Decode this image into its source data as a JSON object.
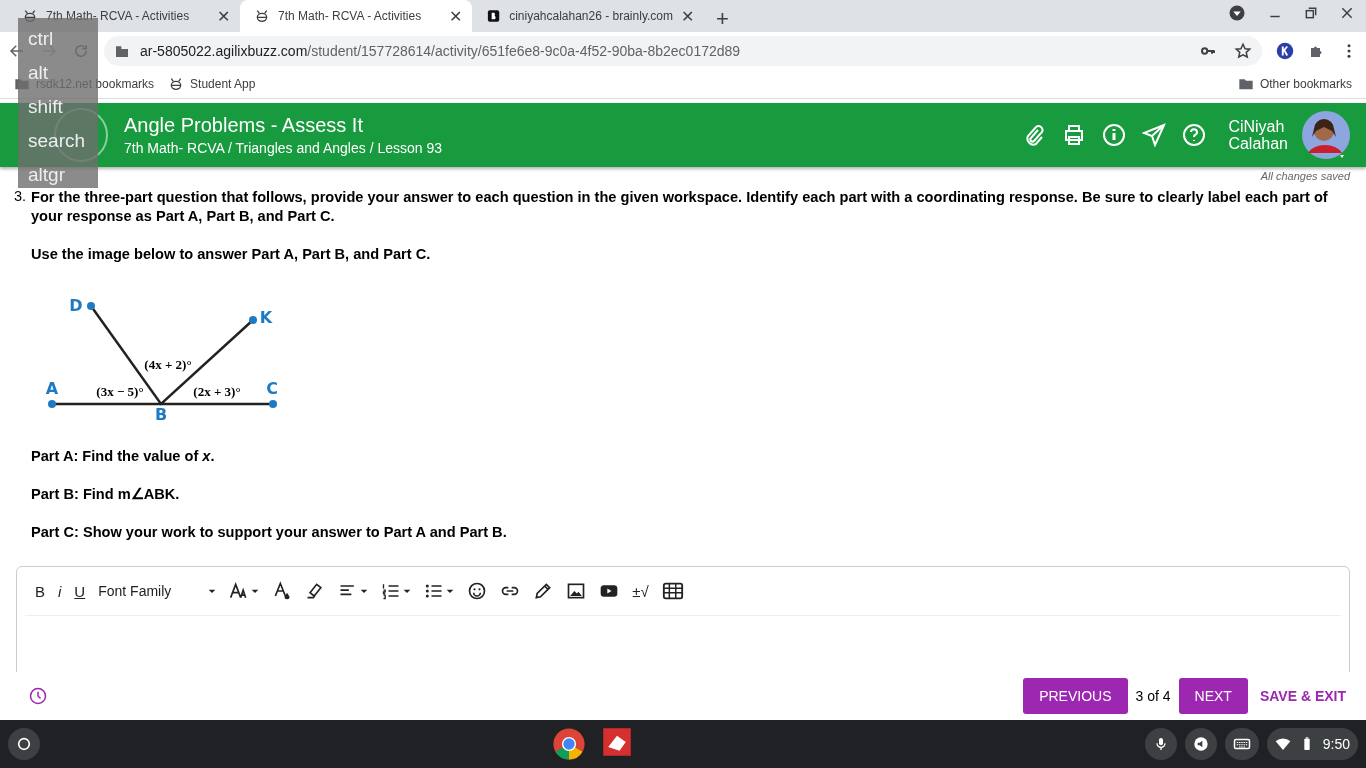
{
  "browser": {
    "tabs": [
      {
        "title": "7th Math- RCVA - Activities",
        "kind": "bee",
        "close": "✕",
        "selected": false
      },
      {
        "title": "7th Math- RCVA - Activities",
        "kind": "bee",
        "close": "✕",
        "selected": true
      },
      {
        "title": "ciniyahcalahan26 - brainly.com",
        "kind": "letter",
        "close": "✕",
        "selected": false
      }
    ],
    "new_tab": "+",
    "address": {
      "host": "ar-5805022.agilixbuzz.com",
      "path": "/student/157728614/activity/651fe6e8-9c0a-4f52-90ba-8b2ec0172d89"
    },
    "bookmarks": [
      {
        "label": "rsdk12.net bookmarks",
        "kind": "folder"
      },
      {
        "label": "Student App",
        "kind": "bee"
      }
    ],
    "other_bookmarks": "Other bookmarks"
  },
  "keyboard_overlay": [
    "ctrl",
    "alt",
    "shift",
    "search",
    "altgr"
  ],
  "header": {
    "title": "Angle Problems - Assess It",
    "breadcrumb": "7th Math- RCVA / Triangles and Angles / Lesson 93",
    "user": [
      "CiNiyah",
      "Calahan"
    ]
  },
  "save_status": "All changes saved",
  "question": {
    "number": "3.",
    "instructions": "For the three-part question that follows, provide your answer to each question in the given workspace. Identify each part with a coordinating response. Be sure to clearly label each part of your response as Part A, Part B, and Part C.",
    "image_prompt": "Use the image below to answer Part A, Part B, and Part C.",
    "diagram": {
      "points": [
        "D",
        "K",
        "A",
        "B",
        "C"
      ],
      "angles": [
        "(4x + 2)°",
        "(3x − 5)°",
        "(2x + 3)°"
      ]
    },
    "parts": [
      "Part A: Find the value of *x*.",
      "Part B: Find m∠ABK.",
      "Part C: Show your work to support your answer to Part A and Part B."
    ]
  },
  "editor": {
    "bold": "B",
    "italic": "i",
    "underline": "U",
    "font_family": "Font Family",
    "math_button": "±√"
  },
  "footer": {
    "previous": "PREVIOUS",
    "position": "3 of 4",
    "next": "NEXT",
    "save_exit": "SAVE & EXIT"
  },
  "taskbar": {
    "time": "9:50"
  }
}
